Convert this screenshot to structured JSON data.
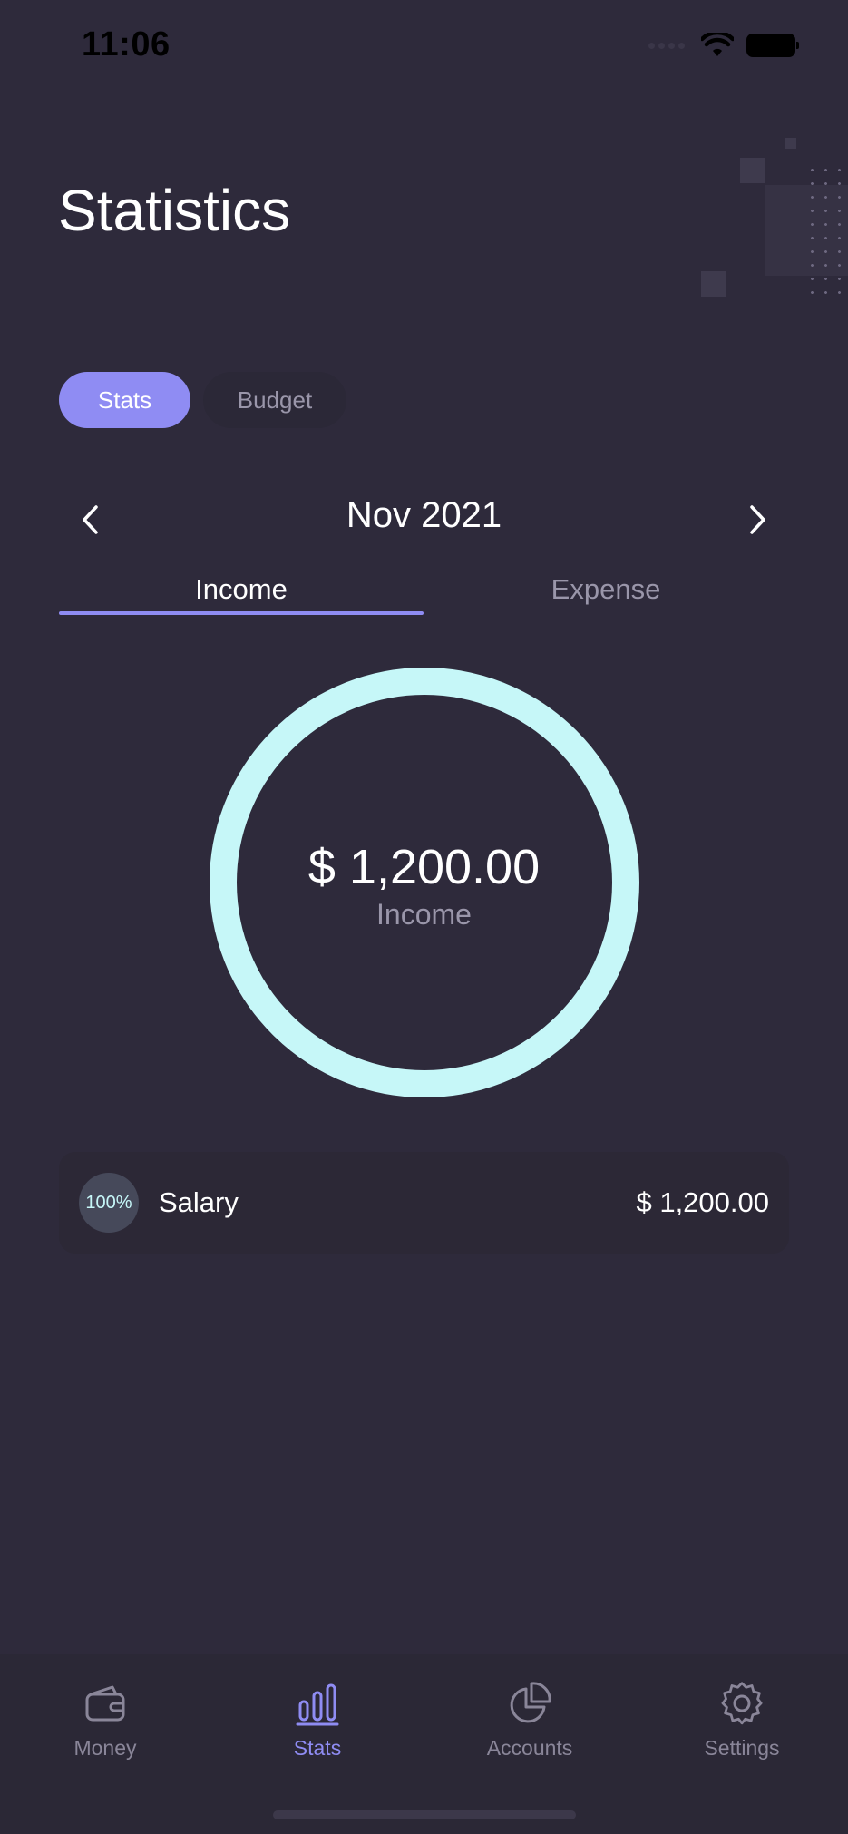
{
  "status_bar": {
    "time": "11:06"
  },
  "header": {
    "title": "Statistics"
  },
  "segments": [
    {
      "label": "Stats",
      "active": true
    },
    {
      "label": "Budget",
      "active": false
    }
  ],
  "period": {
    "label": "Nov 2021"
  },
  "type_tabs": [
    {
      "label": "Income",
      "active": true
    },
    {
      "label": "Expense",
      "active": false
    }
  ],
  "summary": {
    "amount": "$ 1,200.00",
    "label": "Income"
  },
  "chart_data": {
    "type": "pie",
    "categories": [
      "Salary"
    ],
    "values": [
      1200
    ],
    "colors": [
      "#c6f7f8"
    ],
    "style": "donut",
    "center_text": "$ 1,200.00",
    "center_subtext": "Income"
  },
  "categories": [
    {
      "percent": "100%",
      "name": "Salary",
      "amount": "$ 1,200.00"
    }
  ],
  "tabbar": {
    "items": [
      {
        "label": "Money",
        "icon": "wallet-icon",
        "active": false
      },
      {
        "label": "Stats",
        "icon": "bar-chart-icon",
        "active": true
      },
      {
        "label": "Accounts",
        "icon": "pie-chart-icon",
        "active": false
      },
      {
        "label": "Settings",
        "icon": "gear-icon",
        "active": false
      }
    ]
  },
  "colors": {
    "background": "#2e2a3b",
    "accent": "#8f8cf3",
    "chart": "#c6f7f8",
    "muted_text": "#9a96aa"
  }
}
